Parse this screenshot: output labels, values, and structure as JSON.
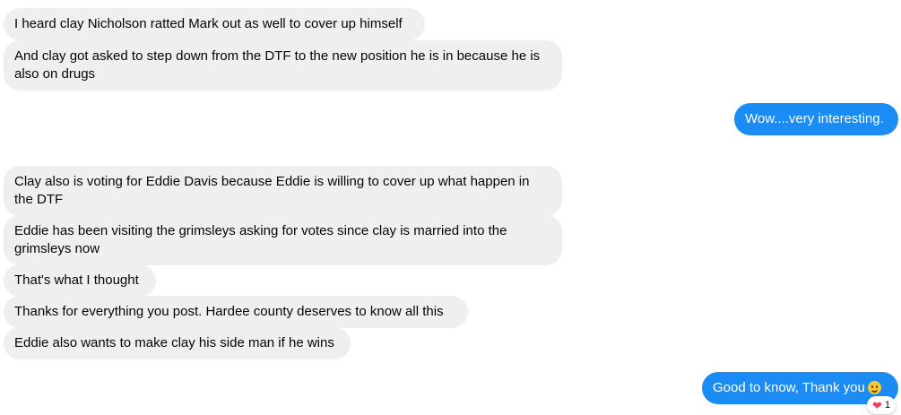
{
  "messages": [
    {
      "direction": "incoming",
      "text": "I heard clay Nicholson ratted Mark out as well to cover up himself"
    },
    {
      "direction": "incoming",
      "text": "And clay got asked to step down from the DTF to the new position he is in because he is also on drugs"
    },
    {
      "direction": "outgoing",
      "text": "Wow....very interesting."
    },
    {
      "direction": "incoming",
      "text": "Clay also is voting for Eddie Davis because Eddie is willing to cover up what happen in the DTF"
    },
    {
      "direction": "incoming",
      "text": "Eddie has been visiting the grimsleys asking for votes since clay is married into the grimsleys now"
    },
    {
      "direction": "incoming",
      "text": "That's what I thought"
    },
    {
      "direction": "incoming",
      "text": "Thanks for everything you post. Hardee county deserves to know all this"
    },
    {
      "direction": "incoming",
      "text": "Eddie also wants to make clay his side man if he wins"
    },
    {
      "direction": "outgoing",
      "text": "Good to know, Thank you",
      "emoji": "slightly-smiling-face-icon",
      "reaction": {
        "icon": "heart-icon",
        "count": "1"
      }
    }
  ],
  "colors": {
    "incoming_bubble": "#efefef",
    "outgoing_bubble": "#1a8cf3",
    "reaction_heart": "#f33e58"
  }
}
